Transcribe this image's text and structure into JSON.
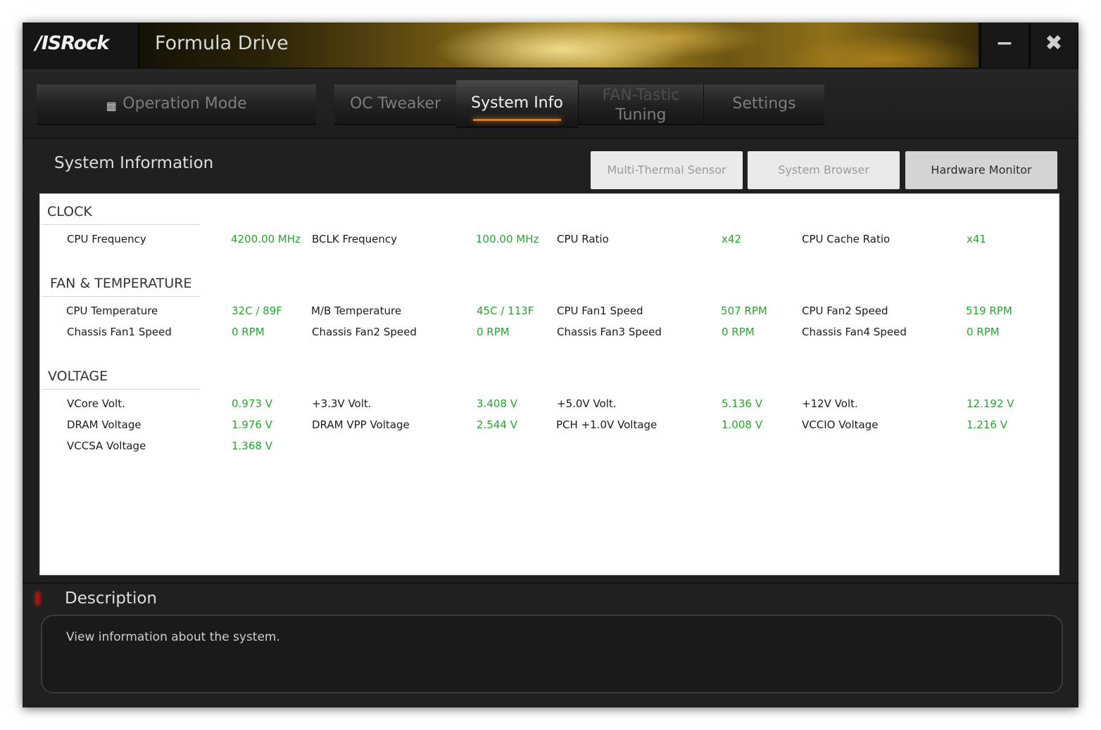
{
  "window": {
    "logo": "/ISRock",
    "title": "Formula Drive",
    "minimize_glyph": "−",
    "close_glyph": "✖"
  },
  "tabs": {
    "operation_mode": "Operation Mode",
    "oc_tweaker": "OC Tweaker",
    "system_info": "System Info",
    "fan_tuning_line1": "FAN-Tastic",
    "fan_tuning_line2": "Tuning",
    "settings": "Settings",
    "active": "System Info",
    "accent_color": "#e07a10"
  },
  "header": {
    "title": "System Information",
    "buttons": {
      "multi_thermal": "Multi-Thermal Sensor",
      "system_browser": "System Browser",
      "hardware_monitor": "Hardware Monitor"
    }
  },
  "clock": {
    "heading": "CLOCK",
    "rows": [
      [
        {
          "label": "CPU Frequency",
          "value": "4200.00 MHz"
        },
        {
          "label": "BCLK Frequency",
          "value": "100.00 MHz"
        },
        {
          "label": "CPU Ratio",
          "value": "x42"
        },
        {
          "label": "CPU Cache Ratio",
          "value": "x41"
        }
      ]
    ]
  },
  "fan_temp": {
    "heading": "FAN & TEMPERATURE",
    "rows": [
      [
        {
          "label": "CPU Temperature",
          "value": "32C / 89F"
        },
        {
          "label": "M/B Temperature",
          "value": "45C / 113F"
        },
        {
          "label": "CPU Fan1 Speed",
          "value": "507 RPM"
        },
        {
          "label": "CPU Fan2 Speed",
          "value": "519 RPM"
        }
      ],
      [
        {
          "label": "Chassis Fan1 Speed",
          "value": "0 RPM"
        },
        {
          "label": "Chassis Fan2 Speed",
          "value": "0 RPM"
        },
        {
          "label": "Chassis Fan3 Speed",
          "value": "0 RPM"
        },
        {
          "label": "Chassis Fan4 Speed",
          "value": "0 RPM"
        }
      ]
    ]
  },
  "voltage": {
    "heading": "VOLTAGE",
    "rows": [
      [
        {
          "label": "VCore Volt.",
          "value": "0.973 V"
        },
        {
          "label": "+3.3V Volt.",
          "value": "3.408 V"
        },
        {
          "label": "+5.0V Volt.",
          "value": "5.136 V"
        },
        {
          "label": "+12V Volt.",
          "value": "12.192 V"
        }
      ],
      [
        {
          "label": "DRAM Voltage",
          "value": "1.976 V"
        },
        {
          "label": "DRAM VPP Voltage",
          "value": "2.544 V"
        },
        {
          "label": "PCH +1.0V Voltage",
          "value": "1.008 V"
        },
        {
          "label": "VCCIO Voltage",
          "value": "1.216 V"
        }
      ],
      [
        {
          "label": "VCCSA Voltage",
          "value": "1.368 V"
        }
      ]
    ]
  },
  "value_color": "#2aa230",
  "description": {
    "title": "Description",
    "text": "View information about the system."
  }
}
